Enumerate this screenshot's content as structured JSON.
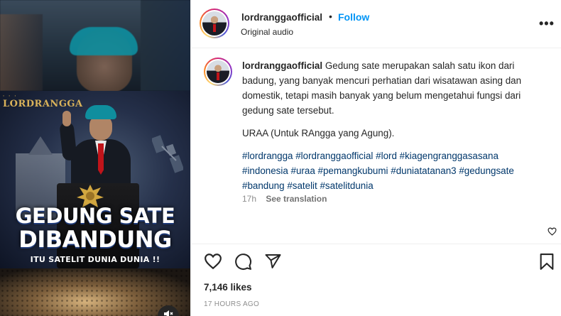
{
  "media": {
    "brand_logo": "LORDRANGGA",
    "headline_line1": "GEDUNG SATE",
    "headline_line2": "DIBANDUNG",
    "headline_line3": "ITU SATELIT DUNIA DUNIA !!",
    "icons": {
      "mute": "speaker-muted-icon"
    }
  },
  "header": {
    "username": "lordranggaofficial",
    "separator": "•",
    "follow_label": "Follow",
    "audio_label": "Original audio",
    "more_label": "•••"
  },
  "caption": {
    "username": "lordranggaofficial",
    "text": "Gedung sate merupakan salah satu ikon dari badung, yang banyak mencuri perhatian dari wisatawan asing dan domestik, tetapi masih banyak yang belum mengetahui fungsi dari gedung sate tersebut.",
    "line2": "URAA (Untuk RAngga yang Agung).",
    "hashtags": [
      "#lordrangga",
      "#lordranggaofficial",
      "#lord",
      "#kiagengranggasasana",
      "#indonesia",
      "#uraa",
      "#pemangkubumi",
      "#duniatatanan3",
      "#gedungsate",
      "#bandung",
      "#satelit",
      "#satelitdunia"
    ],
    "time": "17h",
    "translate_label": "See translation"
  },
  "actions": {
    "icons": [
      "heart-icon",
      "comment-icon",
      "share-icon",
      "bookmark-icon"
    ],
    "likes": "7,146 likes",
    "posted_ago": "17 HOURS AGO"
  }
}
